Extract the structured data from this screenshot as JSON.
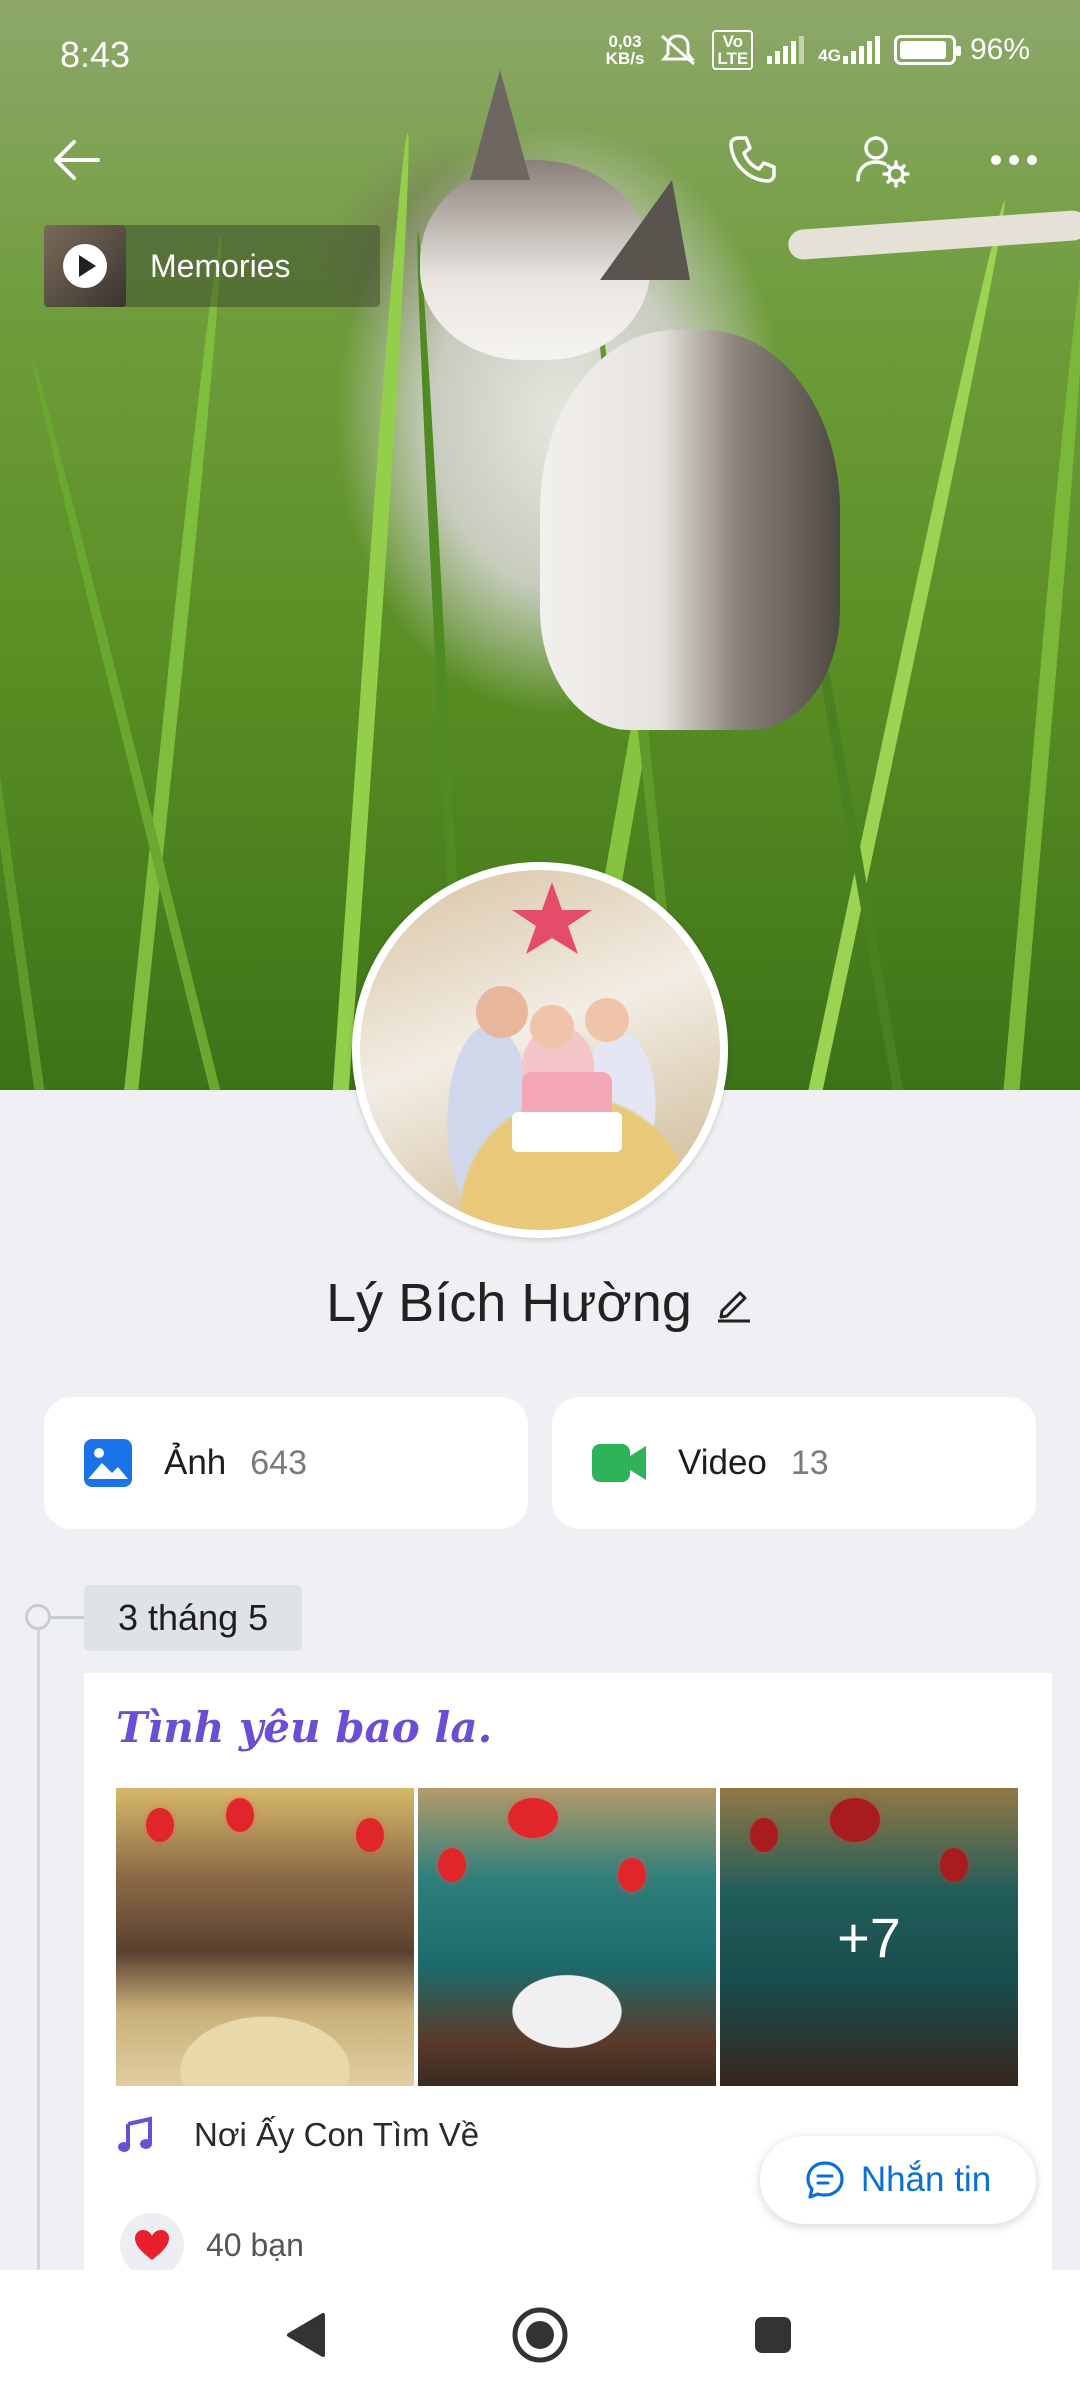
{
  "status": {
    "time": "8:43",
    "net_speed_top": "0,03",
    "net_speed_bottom": "KB/s",
    "volte_top": "Vo",
    "volte_bottom": "LTE",
    "network": "4G",
    "battery": "96%"
  },
  "cover": {
    "memories_label": "Memories"
  },
  "profile": {
    "name": "Lý Bích Hường"
  },
  "media": {
    "photos_label": "Ảnh",
    "photos_count": "643",
    "videos_label": "Video",
    "videos_count": "13"
  },
  "post": {
    "date": "3 tháng 5",
    "title": "Tình yêu bao la.",
    "more_photos": "+7",
    "music": "Nơi Ấy Con Tìm Về",
    "likes": "40 bạn"
  },
  "actions": {
    "message": "Nhắn tin"
  },
  "colors": {
    "accent": "#0b6fd8",
    "title_purple": "#6a4fd6",
    "video_green": "#2fb35a",
    "photo_blue": "#1a73e8"
  }
}
